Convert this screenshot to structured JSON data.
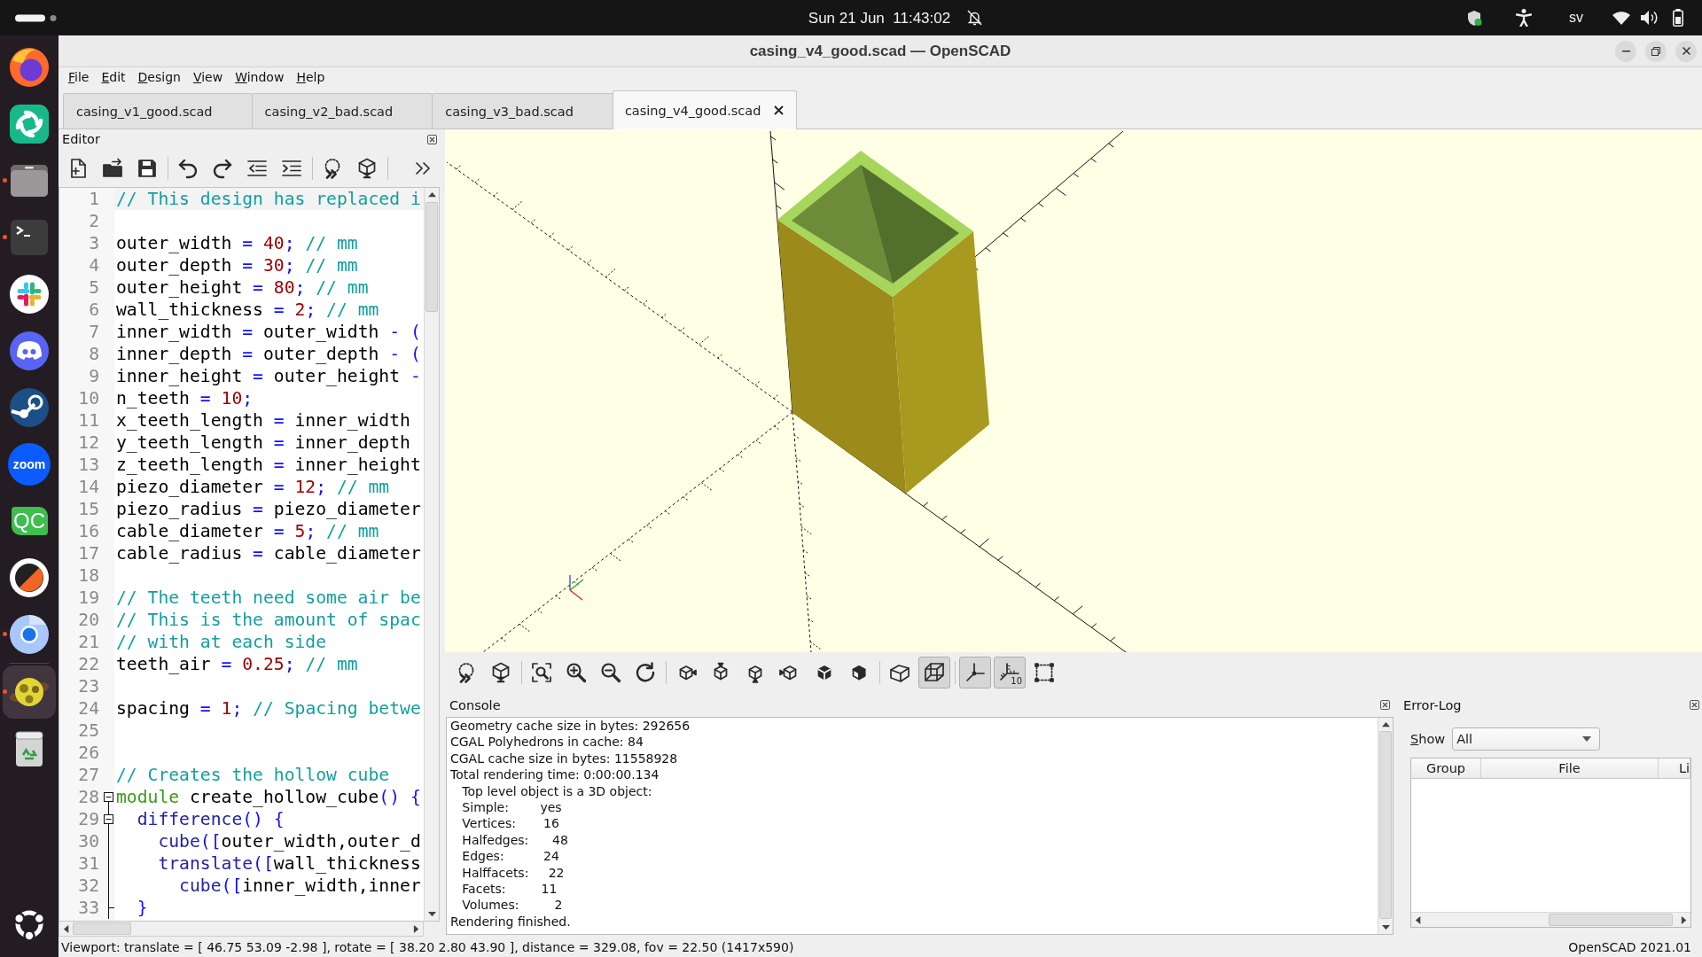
{
  "top_bar": {
    "clock": "Sun 21 Jun  11:43:02",
    "notifications_muted": true,
    "keyboard_layout": "sv"
  },
  "dock": {
    "items": [
      {
        "kind": "firefox",
        "running": false,
        "selected": false
      },
      {
        "kind": "element",
        "running": false,
        "selected": false
      },
      {
        "kind": "files",
        "running": true,
        "selected": false
      },
      {
        "kind": "terminal",
        "running": true,
        "selected": false
      },
      {
        "kind": "slack",
        "running": false,
        "selected": false
      },
      {
        "kind": "discord",
        "running": false,
        "selected": false
      },
      {
        "kind": "steam",
        "running": false,
        "selected": false
      },
      {
        "kind": "zoom",
        "label": "zoom",
        "running": false,
        "selected": false
      },
      {
        "kind": "qtcreator",
        "label": "QC",
        "running": false,
        "selected": false
      },
      {
        "kind": "ring",
        "running": false,
        "selected": false
      },
      {
        "kind": "chromium",
        "running": true,
        "selected": false
      }
    ],
    "extra_items": [
      {
        "kind": "openscad",
        "running": true,
        "selected": true
      },
      {
        "kind": "trash",
        "running": false,
        "selected": false
      },
      {
        "kind": "apps",
        "running": false,
        "selected": false
      }
    ]
  },
  "window": {
    "title": "casing_v4_good.scad — OpenSCAD"
  },
  "menu": [
    "File",
    "Edit",
    "Design",
    "View",
    "Window",
    "Help"
  ],
  "tabs": [
    {
      "label": "casing_v1_good.scad",
      "selected": false
    },
    {
      "label": "casing_v2_bad.scad",
      "selected": false
    },
    {
      "label": "casing_v3_bad.scad",
      "selected": false
    },
    {
      "label": "casing_v4_good.scad",
      "selected": true
    }
  ],
  "editor": {
    "title": "Editor",
    "toolbar_groups": [
      {
        "buttons": [
          {
            "kind": "new"
          },
          {
            "kind": "open"
          },
          {
            "kind": "save"
          }
        ]
      },
      {
        "buttons": [
          {
            "kind": "undo"
          },
          {
            "kind": "redo"
          },
          {
            "kind": "unindent"
          },
          {
            "kind": "indent"
          }
        ]
      },
      {
        "buttons": [
          {
            "kind": "preview"
          },
          {
            "kind": "render"
          }
        ]
      },
      {
        "buttons": [
          {
            "kind": "more"
          }
        ]
      }
    ],
    "lines": [
      {
        "number": "1",
        "kind": "plain",
        "current": true,
        "tokens": [
          {
            "kind": "comment",
            "text": "// This design has replaced i"
          }
        ]
      },
      {
        "number": "2",
        "kind": "plain",
        "current": false
      },
      {
        "number": "3",
        "kind": "plain",
        "current": false,
        "tokens": [
          {
            "kind": "text",
            "text": "outer_width "
          },
          {
            "kind": "op",
            "text": "= "
          },
          {
            "kind": "num",
            "text": "40"
          },
          {
            "kind": "op",
            "text": "; "
          },
          {
            "kind": "comment",
            "text": "// mm"
          }
        ]
      },
      {
        "number": "4",
        "kind": "plain",
        "current": false,
        "tokens": [
          {
            "kind": "text",
            "text": "outer_depth "
          },
          {
            "kind": "op",
            "text": "= "
          },
          {
            "kind": "num",
            "text": "30"
          },
          {
            "kind": "op",
            "text": "; "
          },
          {
            "kind": "comment",
            "text": "// mm"
          }
        ]
      },
      {
        "number": "5",
        "kind": "plain",
        "current": false,
        "tokens": [
          {
            "kind": "text",
            "text": "outer_height "
          },
          {
            "kind": "op",
            "text": "= "
          },
          {
            "kind": "num",
            "text": "80"
          },
          {
            "kind": "op",
            "text": "; "
          },
          {
            "kind": "comment",
            "text": "// mm"
          }
        ]
      },
      {
        "number": "6",
        "kind": "plain",
        "current": false,
        "tokens": [
          {
            "kind": "text",
            "text": "wall_thickness "
          },
          {
            "kind": "op",
            "text": "= "
          },
          {
            "kind": "num",
            "text": "2"
          },
          {
            "kind": "op",
            "text": "; "
          },
          {
            "kind": "comment",
            "text": "// mm"
          }
        ]
      },
      {
        "number": "7",
        "kind": "plain",
        "current": false,
        "tokens": [
          {
            "kind": "text",
            "text": "inner_width "
          },
          {
            "kind": "op",
            "text": "= "
          },
          {
            "kind": "text",
            "text": "outer_width "
          },
          {
            "kind": "op",
            "text": "- ("
          }
        ]
      },
      {
        "number": "8",
        "kind": "plain",
        "current": false,
        "tokens": [
          {
            "kind": "text",
            "text": "inner_depth "
          },
          {
            "kind": "op",
            "text": "= "
          },
          {
            "kind": "text",
            "text": "outer_depth "
          },
          {
            "kind": "op",
            "text": "- ("
          }
        ]
      },
      {
        "number": "9",
        "kind": "plain",
        "current": false,
        "tokens": [
          {
            "kind": "text",
            "text": "inner_height "
          },
          {
            "kind": "op",
            "text": "= "
          },
          {
            "kind": "text",
            "text": "outer_height "
          },
          {
            "kind": "op",
            "text": "-"
          }
        ]
      },
      {
        "number": "10",
        "kind": "plain",
        "current": false,
        "tokens": [
          {
            "kind": "text",
            "text": "n_teeth "
          },
          {
            "kind": "op",
            "text": "= "
          },
          {
            "kind": "num",
            "text": "10"
          },
          {
            "kind": "op",
            "text": ";"
          }
        ]
      },
      {
        "number": "11",
        "kind": "plain",
        "current": false,
        "tokens": [
          {
            "kind": "text",
            "text": "x_teeth_length "
          },
          {
            "kind": "op",
            "text": "= "
          },
          {
            "kind": "text",
            "text": "inner_width"
          }
        ]
      },
      {
        "number": "12",
        "kind": "plain",
        "current": false,
        "tokens": [
          {
            "kind": "text",
            "text": "y_teeth_length "
          },
          {
            "kind": "op",
            "text": "= "
          },
          {
            "kind": "text",
            "text": "inner_depth"
          }
        ]
      },
      {
        "number": "13",
        "kind": "plain",
        "current": false,
        "tokens": [
          {
            "kind": "text",
            "text": "z_teeth_length "
          },
          {
            "kind": "op",
            "text": "= "
          },
          {
            "kind": "text",
            "text": "inner_height"
          }
        ]
      },
      {
        "number": "14",
        "kind": "plain",
        "current": false,
        "tokens": [
          {
            "kind": "text",
            "text": "piezo_diameter "
          },
          {
            "kind": "op",
            "text": "= "
          },
          {
            "kind": "num",
            "text": "12"
          },
          {
            "kind": "op",
            "text": "; "
          },
          {
            "kind": "comment",
            "text": "// mm"
          }
        ]
      },
      {
        "number": "15",
        "kind": "plain",
        "current": false,
        "tokens": [
          {
            "kind": "text",
            "text": "piezo_radius "
          },
          {
            "kind": "op",
            "text": "= "
          },
          {
            "kind": "text",
            "text": "piezo_diameter"
          }
        ]
      },
      {
        "number": "16",
        "kind": "plain",
        "current": false,
        "tokens": [
          {
            "kind": "text",
            "text": "cable_diameter "
          },
          {
            "kind": "op",
            "text": "= "
          },
          {
            "kind": "num",
            "text": "5"
          },
          {
            "kind": "op",
            "text": "; "
          },
          {
            "kind": "comment",
            "text": "// mm"
          }
        ]
      },
      {
        "number": "17",
        "kind": "plain",
        "current": false,
        "tokens": [
          {
            "kind": "text",
            "text": "cable_radius "
          },
          {
            "kind": "op",
            "text": "= "
          },
          {
            "kind": "text",
            "text": "cable_diameter"
          }
        ]
      },
      {
        "number": "18",
        "kind": "plain",
        "current": false
      },
      {
        "number": "19",
        "kind": "plain",
        "current": false,
        "tokens": [
          {
            "kind": "comment",
            "text": "// The teeth need some air be"
          }
        ]
      },
      {
        "number": "20",
        "kind": "plain",
        "current": false,
        "tokens": [
          {
            "kind": "comment",
            "text": "// This is the amount of spac"
          }
        ]
      },
      {
        "number": "21",
        "kind": "plain",
        "current": false,
        "tokens": [
          {
            "kind": "comment",
            "text": "// with at each side"
          }
        ]
      },
      {
        "number": "22",
        "kind": "plain",
        "current": false,
        "tokens": [
          {
            "kind": "text",
            "text": "teeth_air "
          },
          {
            "kind": "op",
            "text": "= "
          },
          {
            "kind": "num",
            "text": "0.25"
          },
          {
            "kind": "op",
            "text": "; "
          },
          {
            "kind": "comment",
            "text": "// mm"
          }
        ]
      },
      {
        "number": "23",
        "kind": "plain",
        "current": false
      },
      {
        "number": "24",
        "kind": "plain",
        "current": false,
        "tokens": [
          {
            "kind": "text",
            "text": "spacing "
          },
          {
            "kind": "op",
            "text": "= "
          },
          {
            "kind": "num",
            "text": "1"
          },
          {
            "kind": "op",
            "text": "; "
          },
          {
            "kind": "comment",
            "text": "// Spacing betwe"
          }
        ]
      },
      {
        "number": "25",
        "kind": "plain",
        "current": false
      },
      {
        "number": "26",
        "kind": "plain",
        "current": false
      },
      {
        "number": "27",
        "kind": "plain",
        "current": false,
        "tokens": [
          {
            "kind": "comment",
            "text": "// Creates the hollow cube"
          }
        ]
      },
      {
        "number": "28",
        "kind": "fold_start",
        "current": false,
        "tokens": [
          {
            "kind": "keyword",
            "text": "module"
          },
          {
            "kind": "text",
            "text": " create_hollow_cube"
          },
          {
            "kind": "op",
            "text": "() {"
          }
        ]
      },
      {
        "number": "29",
        "kind": "fold_start",
        "current": false,
        "tokens": [
          {
            "kind": "builtin",
            "text": "  difference"
          },
          {
            "kind": "op",
            "text": "() {"
          }
        ]
      },
      {
        "number": "30",
        "kind": "fold_body",
        "current": false,
        "tokens": [
          {
            "kind": "builtin",
            "text": "    cube"
          },
          {
            "kind": "op",
            "text": "(["
          },
          {
            "kind": "text",
            "text": "outer_width,outer_d"
          }
        ]
      },
      {
        "number": "31",
        "kind": "fold_body",
        "current": false,
        "tokens": [
          {
            "kind": "builtin",
            "text": "    translate"
          },
          {
            "kind": "op",
            "text": "(["
          },
          {
            "kind": "text",
            "text": "wall_thickness"
          }
        ]
      },
      {
        "number": "32",
        "kind": "fold_body",
        "current": false,
        "tokens": [
          {
            "kind": "builtin",
            "text": "      cube"
          },
          {
            "kind": "op",
            "text": "(["
          },
          {
            "kind": "text",
            "text": "inner_width,inner"
          }
        ]
      },
      {
        "number": "33",
        "kind": "fold_end",
        "current": false,
        "tokens": [
          {
            "kind": "op",
            "text": "  }"
          }
        ]
      }
    ]
  },
  "viewer": {
    "toolbar_groups": [
      {
        "buttons": [
          {
            "kind": "preview",
            "pressed": false
          },
          {
            "kind": "render",
            "pressed": false
          }
        ]
      },
      {
        "buttons": [
          {
            "kind": "view_all",
            "pressed": false
          },
          {
            "kind": "zoom_in",
            "pressed": false
          },
          {
            "kind": "zoom_out",
            "pressed": false
          },
          {
            "kind": "reset_view",
            "pressed": false
          }
        ]
      },
      {
        "buttons": [
          {
            "kind": "view_right",
            "pressed": false
          },
          {
            "kind": "view_top",
            "pressed": false
          },
          {
            "kind": "view_bottom",
            "pressed": false
          },
          {
            "kind": "view_left",
            "pressed": false
          },
          {
            "kind": "view_front",
            "pressed": false
          },
          {
            "kind": "view_back",
            "pressed": false
          }
        ]
      },
      {
        "buttons": [
          {
            "kind": "perspective",
            "pressed": false
          },
          {
            "kind": "orthogonal",
            "pressed": true
          }
        ]
      },
      {
        "buttons": [
          {
            "kind": "axes",
            "pressed": true
          },
          {
            "kind": "scale_markers",
            "pressed": true,
            "label": "10"
          },
          {
            "kind": "edges",
            "pressed": false
          }
        ]
      }
    ]
  },
  "console": {
    "title": "Console",
    "lines": [
      "Geometry cache size in bytes: 292656",
      "CGAL Polyhedrons in cache: 84",
      "CGAL cache size in bytes: 11558928",
      "Total rendering time: 0:00:00.134",
      "   Top level object is a 3D object:",
      "   Simple:        yes",
      "   Vertices:       16",
      "   Halfedges:      48",
      "   Edges:          24",
      "   Halffacets:     22",
      "   Facets:         11",
      "   Volumes:         2",
      "Rendering finished."
    ]
  },
  "error_log": {
    "title": "Error-Log",
    "filter_label": "Show",
    "filter_value": "All",
    "columns": [
      "Group",
      "File",
      "Li"
    ]
  },
  "status_bar": {
    "viewport": "Viewport: translate = [ 46.75 53.09 -2.98 ], rotate = [ 38.20 2.80 43.90 ], distance = 329.08, fov = 22.50 (1417x590)",
    "version": "OpenSCAD 2021.01"
  }
}
